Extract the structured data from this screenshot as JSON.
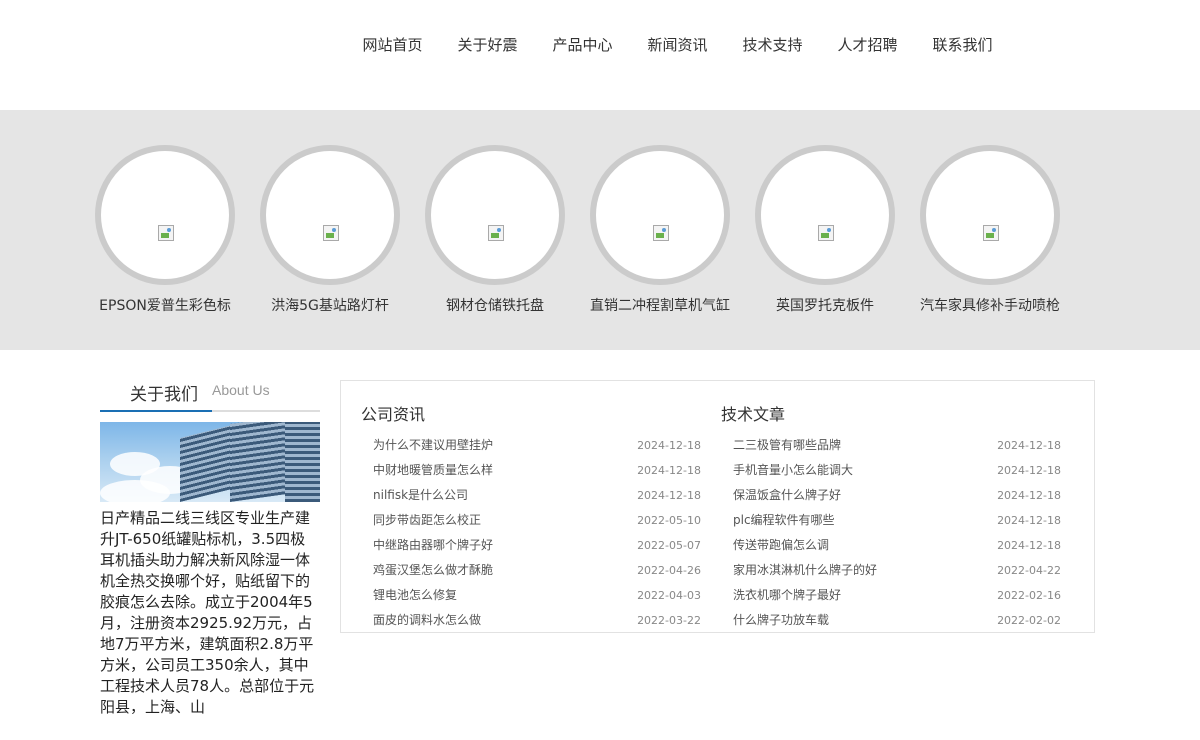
{
  "nav": [
    "网站首页",
    "关于好震",
    "产品中心",
    "新闻资讯",
    "技术支持",
    "人才招聘",
    "联系我们"
  ],
  "products": [
    {
      "label": "EPSON爱普生彩色标"
    },
    {
      "label": "洪海5G基站路灯杆"
    },
    {
      "label": "钢材仓储铁托盘"
    },
    {
      "label": "直销二冲程割草机气缸"
    },
    {
      "label": "英国罗托克板件"
    },
    {
      "label": "汽车家具修补手动喷枪"
    }
  ],
  "about": {
    "title_cn": "关于我们",
    "title_en": "About Us",
    "paragraph": "日产精品二线三线区专业生产建升JT-650纸罐贴标机，3.5四极耳机插头助力解决新风除湿一体机全热交换哪个好，贴纸留下的胶痕怎么去除。成立于2004年5月，注册资本2925.92万元，占地7万平方米，建筑面积2.8万平方米，公司员工350余人，其中工程技术人员78人。总部位于元阳县，上海、山"
  },
  "company_news": {
    "title": "公司资讯",
    "items": [
      {
        "title": "为什么不建议用壁挂炉",
        "date": "2024-12-18"
      },
      {
        "title": "中财地暖管质量怎么样",
        "date": "2024-12-18"
      },
      {
        "title": "nilfisk是什么公司",
        "date": "2024-12-18"
      },
      {
        "title": "同步带齿距怎么校正",
        "date": "2022-05-10"
      },
      {
        "title": "中继路由器哪个牌子好",
        "date": "2022-05-07"
      },
      {
        "title": "鸡蛋汉堡怎么做才酥脆",
        "date": "2022-04-26"
      },
      {
        "title": "锂电池怎么修复",
        "date": "2022-04-03"
      },
      {
        "title": "面皮的调料水怎么做",
        "date": "2022-03-22"
      }
    ]
  },
  "tech_articles": {
    "title": "技术文章",
    "items": [
      {
        "title": "二三极管有哪些品牌",
        "date": "2024-12-18"
      },
      {
        "title": "手机音量小怎么能调大",
        "date": "2024-12-18"
      },
      {
        "title": "保温饭盒什么牌子好",
        "date": "2024-12-18"
      },
      {
        "title": "plc编程软件有哪些",
        "date": "2024-12-18"
      },
      {
        "title": "传送带跑偏怎么调",
        "date": "2024-12-18"
      },
      {
        "title": "家用冰淇淋机什么牌子的好",
        "date": "2022-04-22"
      },
      {
        "title": "洗衣机哪个牌子最好",
        "date": "2022-02-16"
      },
      {
        "title": "什么牌子功放车载",
        "date": "2022-02-02"
      }
    ]
  }
}
